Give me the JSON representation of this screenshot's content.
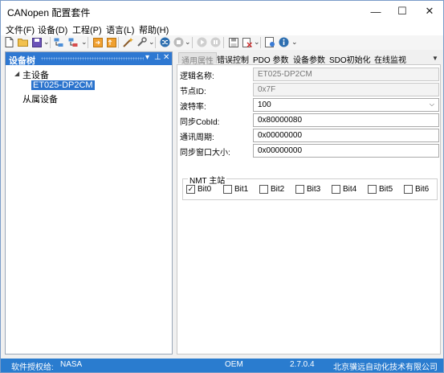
{
  "window": {
    "title": "CANopen 配置套件",
    "minimize_glyph": "—",
    "maximize_glyph": "☐",
    "close_glyph": "✕"
  },
  "menu": [
    "文件(F)",
    "设备(D)",
    "工程(P)",
    "语言(L)",
    "帮助(H)"
  ],
  "toolbar": {
    "icons": [
      "new-file-icon",
      "open-folder-icon",
      "save-icon",
      "add-device-icon",
      "remove-device-icon",
      "import-icon",
      "export-icon",
      "wand-icon",
      "tools-icon",
      "shuffle-icon",
      "stop-icon",
      "play-icon",
      "pause-icon",
      "floppy-icon",
      "delete-icon",
      "settings-icon",
      "info-icon"
    ],
    "overflow_glyph": "⌄",
    "colors": {
      "accent": "#2e78d2",
      "warning": "#f0a030",
      "error": "#d03030"
    }
  },
  "dock": {
    "title": "设备树",
    "dropdown_glyph": "▾",
    "pin_glyph": "⊥",
    "close_glyph": "✕",
    "header_color": "#2e78d2"
  },
  "tree": {
    "master": {
      "label": "主设备",
      "expander": "◢"
    },
    "master_child": {
      "label": "ET025-DP2CM"
    },
    "slave": {
      "label": "从属设备"
    }
  },
  "tabs": {
    "items": [
      "通用属性",
      "错误控制",
      "PDO 参数",
      "设备参数",
      "SDO初始化",
      "在线监视"
    ],
    "active_index": 0,
    "scroll_glyph": "▼"
  },
  "form": {
    "logic_name": {
      "label": "逻辑名称:",
      "value": "ET025-DP2CM"
    },
    "node_id": {
      "label": "节点ID:",
      "value": "0x7F"
    },
    "baud_rate": {
      "label": "波特率:",
      "value": "100"
    },
    "sync_cob_id": {
      "label": "同步CobId:",
      "value": "0x80000080"
    },
    "comm_cycle": {
      "label": "通讯周期:",
      "value": "0x00000000"
    },
    "sync_window": {
      "label": "同步窗口大小:",
      "value": "0x00000000"
    }
  },
  "nmt": {
    "title": "NMT 主站",
    "check_glyph": "✓",
    "bits": [
      {
        "label": "Bit0",
        "checked": true
      },
      {
        "label": "Bit1",
        "checked": false
      },
      {
        "label": "Bit2",
        "checked": false
      },
      {
        "label": "Bit3",
        "checked": false
      },
      {
        "label": "Bit4",
        "checked": false
      },
      {
        "label": "Bit5",
        "checked": false
      },
      {
        "label": "Bit6",
        "checked": false
      }
    ]
  },
  "status": {
    "license_label": "软件授权给:",
    "license_value": "NASA",
    "edition": "OEM",
    "version": "2.7.0.4",
    "company": "北京骥远自动化技术有限公司",
    "bar_color": "#2a7ccf"
  }
}
